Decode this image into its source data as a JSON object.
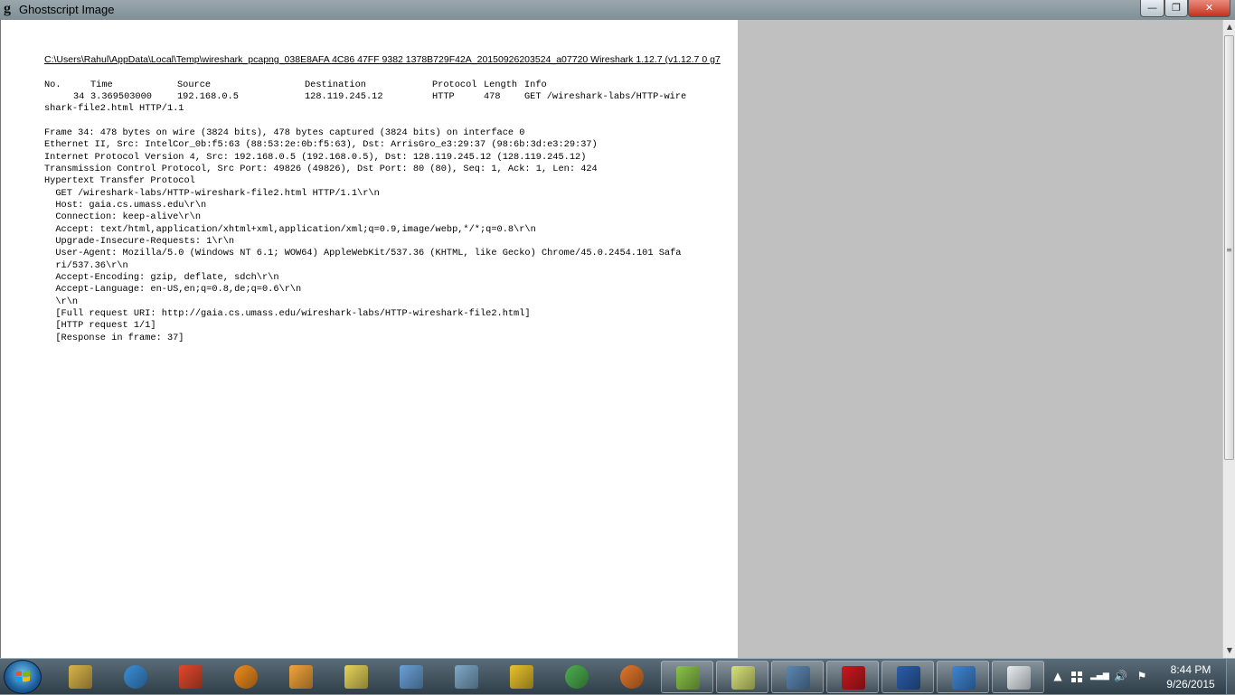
{
  "window": {
    "title": "Ghostscript Image",
    "minimize_glyph": "—",
    "maximize_glyph": "❐",
    "close_glyph": "✕"
  },
  "document": {
    "path_line": "C:\\Users\\Rahul\\AppData\\Local\\Temp\\wireshark_pcapng_038E8AFA 4C86 47FF 9382 1378B729F42A_20150926203524_a07720   Wireshark 1.12.7 (v1.12.7 0 g7",
    "header": {
      "no": "No.",
      "time": "Time",
      "source": "Source",
      "destination": "Destination",
      "protocol": "Protocol",
      "length": "Length",
      "info": "Info"
    },
    "packet": {
      "no": "34",
      "time": "3.369503000",
      "source": "192.168.0.5",
      "destination": "128.119.245.12",
      "protocol": "HTTP",
      "length": "478",
      "info": "GET /wireshark-labs/HTTP-wire",
      "info_wrap": "shark-file2.html HTTP/1.1"
    },
    "detail_lines": [
      "Frame 34: 478 bytes on wire (3824 bits), 478 bytes captured (3824 bits) on interface 0",
      "Ethernet II, Src: IntelCor_0b:f5:63 (88:53:2e:0b:f5:63), Dst: ArrisGro_e3:29:37 (98:6b:3d:e3:29:37)",
      "Internet Protocol Version 4, Src: 192.168.0.5 (192.168.0.5), Dst: 128.119.245.12 (128.119.245.12)",
      "Transmission Control Protocol, Src Port: 49826 (49826), Dst Port: 80 (80), Seq: 1, Ack: 1, Len: 424",
      "Hypertext Transfer Protocol",
      "  GET /wireshark-labs/HTTP-wireshark-file2.html HTTP/1.1\\r\\n",
      "  Host: gaia.cs.umass.edu\\r\\n",
      "  Connection: keep-alive\\r\\n",
      "  Accept: text/html,application/xhtml+xml,application/xml;q=0.9,image/webp,*/*;q=0.8\\r\\n",
      "  Upgrade-Insecure-Requests: 1\\r\\n",
      "  User-Agent: Mozilla/5.0 (Windows NT 6.1; WOW64) AppleWebKit/537.36 (KHTML, like Gecko) Chrome/45.0.2454.101 Safa",
      "  ri/537.36\\r\\n",
      "  Accept-Encoding: gzip, deflate, sdch\\r\\n",
      "  Accept-Language: en-US,en;q=0.8,de;q=0.6\\r\\n",
      "  \\r\\n",
      "  [Full request URI: http://gaia.cs.umass.edu/wireshark-labs/HTTP-wireshark-file2.html]",
      "  [HTTP request 1/1]",
      "  [Response in frame: 37]"
    ]
  },
  "scrollbar": {
    "up": "▲",
    "down": "▼",
    "grip": "≡"
  },
  "taskbar": {
    "apps": [
      {
        "name": "explorer",
        "color": "#d9b44a",
        "state": "pinned"
      },
      {
        "name": "internet-explorer",
        "color": "#3a8fd9",
        "state": "pinned"
      },
      {
        "name": "git",
        "color": "#e0492d",
        "state": "pinned"
      },
      {
        "name": "vlc",
        "color": "#f08c1e",
        "state": "pinned"
      },
      {
        "name": "media-player",
        "color": "#f3a43b",
        "state": "pinned"
      },
      {
        "name": "texmaker",
        "color": "#e6d45a",
        "state": "pinned"
      },
      {
        "name": "virtualbox",
        "color": "#6aa0d8",
        "state": "pinned"
      },
      {
        "name": "calculator",
        "color": "#7fa9c8",
        "state": "pinned"
      },
      {
        "name": "winscp",
        "color": "#e8c22c",
        "state": "pinned"
      },
      {
        "name": "chrome",
        "color": "#4caf50",
        "state": "pinned"
      },
      {
        "name": "matlab",
        "color": "#e2772a",
        "state": "pinned"
      },
      {
        "name": "notepad-plus-plus",
        "color": "#8bc34a",
        "state": "open"
      },
      {
        "name": "sticky-notes",
        "color": "#d8e27a",
        "state": "open"
      },
      {
        "name": "remote-desktop",
        "color": "#5c87b2",
        "state": "open"
      },
      {
        "name": "adobe-reader",
        "color": "#c8191e",
        "state": "open"
      },
      {
        "name": "word",
        "color": "#2b5eaa",
        "state": "open"
      },
      {
        "name": "wireshark",
        "color": "#3f86d4",
        "state": "open"
      },
      {
        "name": "ghostscript-viewer",
        "color": "#e8eef2",
        "state": "open"
      }
    ],
    "tray": {
      "chevron": "▲",
      "network": "▂▄▆",
      "volume": "🔊",
      "flag": "⚑"
    },
    "clock": {
      "time": "8:44 PM",
      "date": "9/26/2015"
    }
  }
}
